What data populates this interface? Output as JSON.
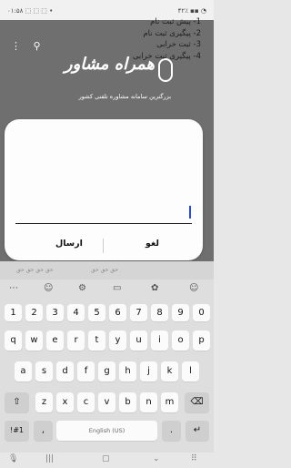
{
  "status": {
    "left": "۰۱:۵۸ ⬚ ⬚ ⬚ •",
    "right": "۴۲٪ ▪▪ ◔"
  },
  "top_icons": {
    "menu": "⋮",
    "search": "⚲"
  },
  "logo": {
    "title": "همراه مشاور",
    "subtitle": "بزرگترین سامانه مشاوره تلفنی کشور"
  },
  "dialog": {
    "menu": [
      "1- پیش ثبت نام",
      "2- پیگیری ثبت نام",
      "3- ثبت خرابی",
      "4- پیگیری ثبت خرابی"
    ],
    "input_value": "",
    "cancel_label": "لغو",
    "send_label": "ارسال"
  },
  "keyboard": {
    "suggestions": [
      "حق حق حق حق",
      "حق حق حق"
    ],
    "toolbar": [
      "⋯",
      "☺",
      "⚙",
      "▭",
      "✿",
      "☺"
    ],
    "row_num": [
      "1",
      "2",
      "3",
      "4",
      "5",
      "6",
      "7",
      "8",
      "9",
      "0"
    ],
    "row1": [
      "q",
      "w",
      "e",
      "r",
      "t",
      "y",
      "u",
      "i",
      "o",
      "p"
    ],
    "row2": [
      "a",
      "s",
      "d",
      "f",
      "g",
      "h",
      "j",
      "k",
      "l"
    ],
    "row3": [
      "z",
      "x",
      "c",
      "v",
      "b",
      "n",
      "m"
    ],
    "shift": "⇧",
    "backspace": "⌫",
    "sym": "!#1",
    "comma": ",",
    "space_label": "English (US)",
    "period": ".",
    "enter": "↵"
  },
  "navbar": {
    "mic": "🎙",
    "recents": "|||",
    "home": "▢",
    "back": "⌄",
    "grid": "⠿"
  }
}
